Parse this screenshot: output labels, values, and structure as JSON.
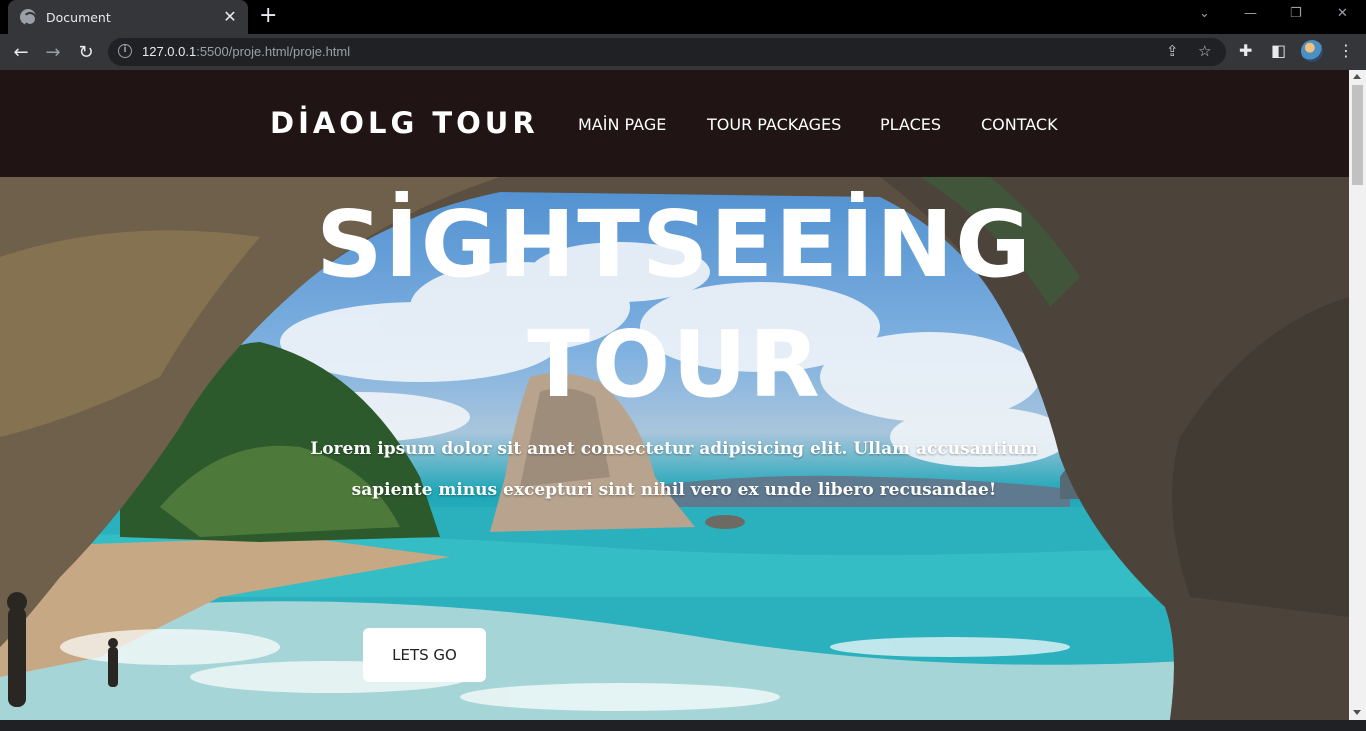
{
  "browser": {
    "tab_title": "Document",
    "url_host": "127.0.0.1",
    "url_rest": ":5500/proje.html/proje.html",
    "icons": [
      "globe-icon",
      "close-icon",
      "plus-icon",
      "back-icon",
      "forward-icon",
      "reload-icon",
      "info-icon",
      "share-icon",
      "star-icon",
      "extensions-icon",
      "sidepanel-icon",
      "profile-avatar",
      "menu-icon",
      "minimize-icon",
      "restore-icon",
      "window-close-icon",
      "tab-search-icon"
    ]
  },
  "site": {
    "logo": "DİAOLG TOUR",
    "nav": [
      "MAİN PAGE",
      "TOUR PACKAGES",
      "PLACES",
      "CONTACK"
    ],
    "hero": {
      "title_line1": "SİGHTSEEİNG",
      "title_line2": "TOUR",
      "text_line1": "Lorem ipsum dolor sit amet consectetur adipisicing elit. Ullam accusantium",
      "text_line2": "sapiente minus excepturi sint nihil vero ex unde libero recusandae!",
      "button": "LETS GO"
    }
  },
  "colors": {
    "nav_background": "#201414",
    "text": "#ffffff",
    "button_background": "#ffffff"
  }
}
